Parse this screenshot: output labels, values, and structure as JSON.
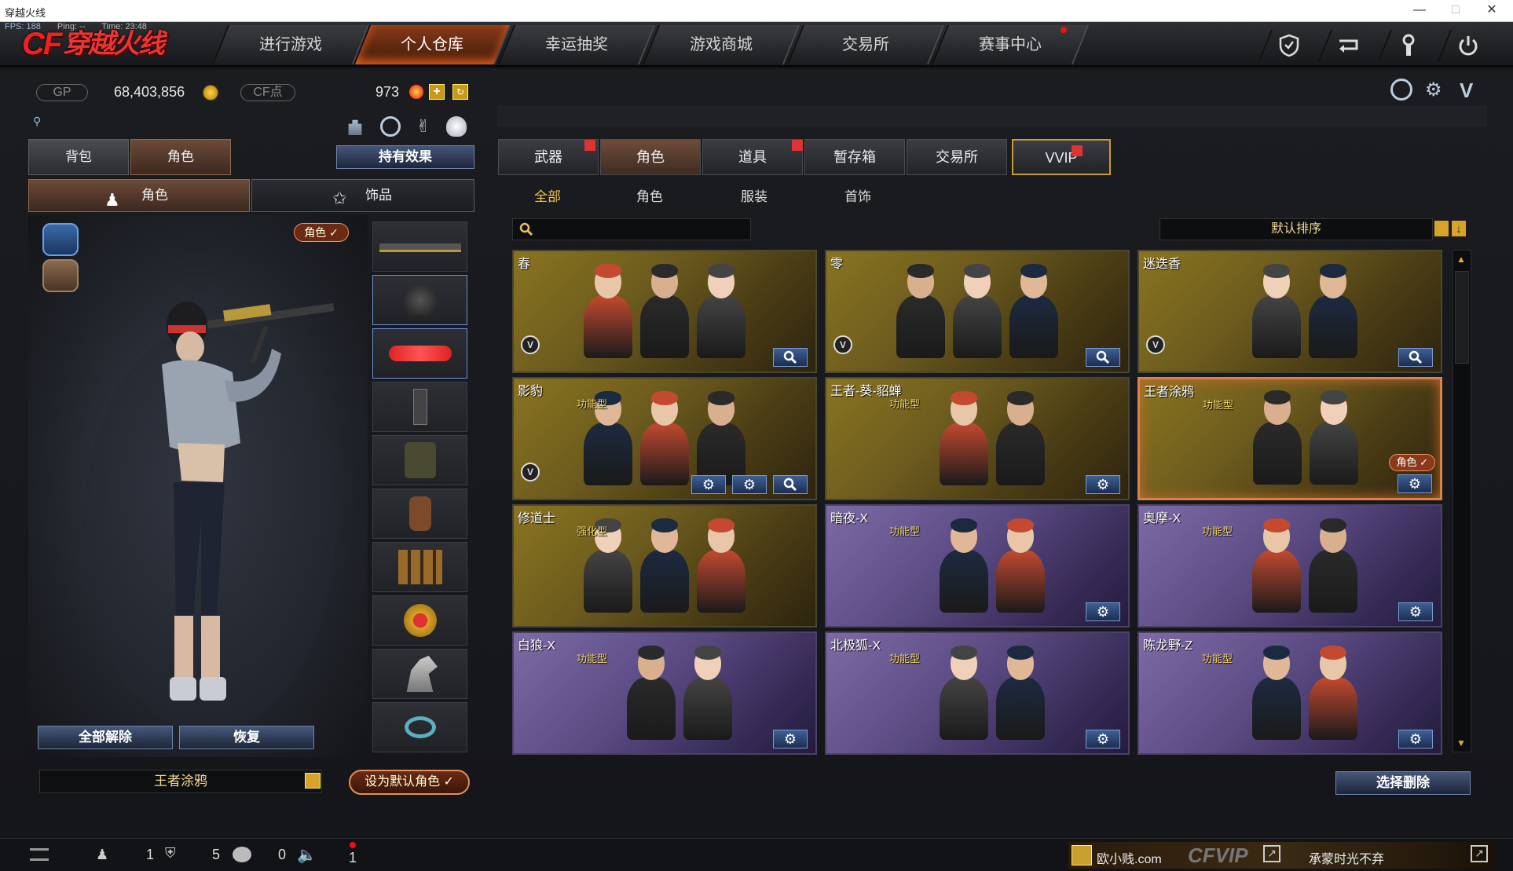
{
  "window": {
    "title": "穿越火线"
  },
  "stats": {
    "fps": "FPS: 188",
    "ping": "Ping: --",
    "time": "Time: 23:48"
  },
  "logo": {
    "text": "穿越火线"
  },
  "nav": {
    "tabs": [
      {
        "label": "进行游戏"
      },
      {
        "label": "个人仓库"
      },
      {
        "label": "幸运抽奖"
      },
      {
        "label": "游戏商城"
      },
      {
        "label": "交易所"
      },
      {
        "label": "赛事中心"
      }
    ],
    "active_index": 1
  },
  "currency": {
    "gp_label": "GP",
    "gp_value": "68,403,856",
    "cf_label": "CF点",
    "cf_value": "973"
  },
  "left": {
    "tab_bag": "背包",
    "tab_role": "角色",
    "effect_button": "持有效果",
    "sub_role": "角色",
    "sub_accessory": "饰品",
    "role_tag": "角色 ✓",
    "unequip_all": "全部解除",
    "restore": "恢复",
    "current_role": "王者涂鸦",
    "set_default": "设为默认角色"
  },
  "right": {
    "tabs": [
      {
        "label": "武器"
      },
      {
        "label": "角色"
      },
      {
        "label": "道具"
      },
      {
        "label": "暂存箱"
      },
      {
        "label": "交易所"
      },
      {
        "label": "VVIP"
      }
    ],
    "subtabs": [
      {
        "label": "全部"
      },
      {
        "label": "角色"
      },
      {
        "label": "服装"
      },
      {
        "label": "首饰"
      }
    ],
    "search_placeholder": "",
    "sort_label": "默认排序",
    "delete_button": "选择删除",
    "cards": [
      {
        "name": "春",
        "type": "",
        "theme": "gold",
        "vip": "V",
        "buttons": [
          "search"
        ]
      },
      {
        "name": "零",
        "type": "",
        "theme": "gold",
        "vip": "V",
        "buttons": [
          "search"
        ]
      },
      {
        "name": "迷迭香",
        "type": "",
        "theme": "gold",
        "vip": "V",
        "buttons": [
          "search"
        ]
      },
      {
        "name": "影豹",
        "type": "功能型",
        "theme": "gold",
        "vip": "V",
        "buttons": [
          "gear2",
          "gear",
          "search"
        ]
      },
      {
        "name": "王者-葵-貂蝉",
        "type": "功能型",
        "theme": "gold",
        "vip": "",
        "buttons": [
          "gear2"
        ]
      },
      {
        "name": "王者涂鸦",
        "type": "功能型",
        "theme": "gold",
        "vip": "",
        "buttons": [
          "gear2"
        ],
        "selected": true,
        "badge": "角色 ✓"
      },
      {
        "name": "修道士",
        "type": "强化型",
        "theme": "gold",
        "vip": "",
        "buttons": []
      },
      {
        "name": "暗夜-X",
        "type": "功能型",
        "theme": "purple",
        "vip": "",
        "buttons": [
          "gear2"
        ]
      },
      {
        "name": "奥摩-X",
        "type": "功能型",
        "theme": "purple",
        "vip": "",
        "buttons": [
          "gear2"
        ]
      },
      {
        "name": "白狼-X",
        "type": "功能型",
        "theme": "purple",
        "vip": "",
        "buttons": [
          "gear2"
        ]
      },
      {
        "name": "北极狐-X",
        "type": "功能型",
        "theme": "purple",
        "vip": "",
        "buttons": [
          "gear2"
        ]
      },
      {
        "name": "陈龙野-Z",
        "type": "功能型",
        "theme": "purple",
        "vip": "",
        "buttons": [
          "gear2"
        ]
      }
    ]
  },
  "bottom": {
    "friends_count": "1",
    "clan_count": "5",
    "chat_count": "0",
    "sound_count": "1",
    "ticker_user": "欧小贱.com",
    "ticker_brand": "CFVIP",
    "ticker_msg": "承蒙时光不弃"
  }
}
